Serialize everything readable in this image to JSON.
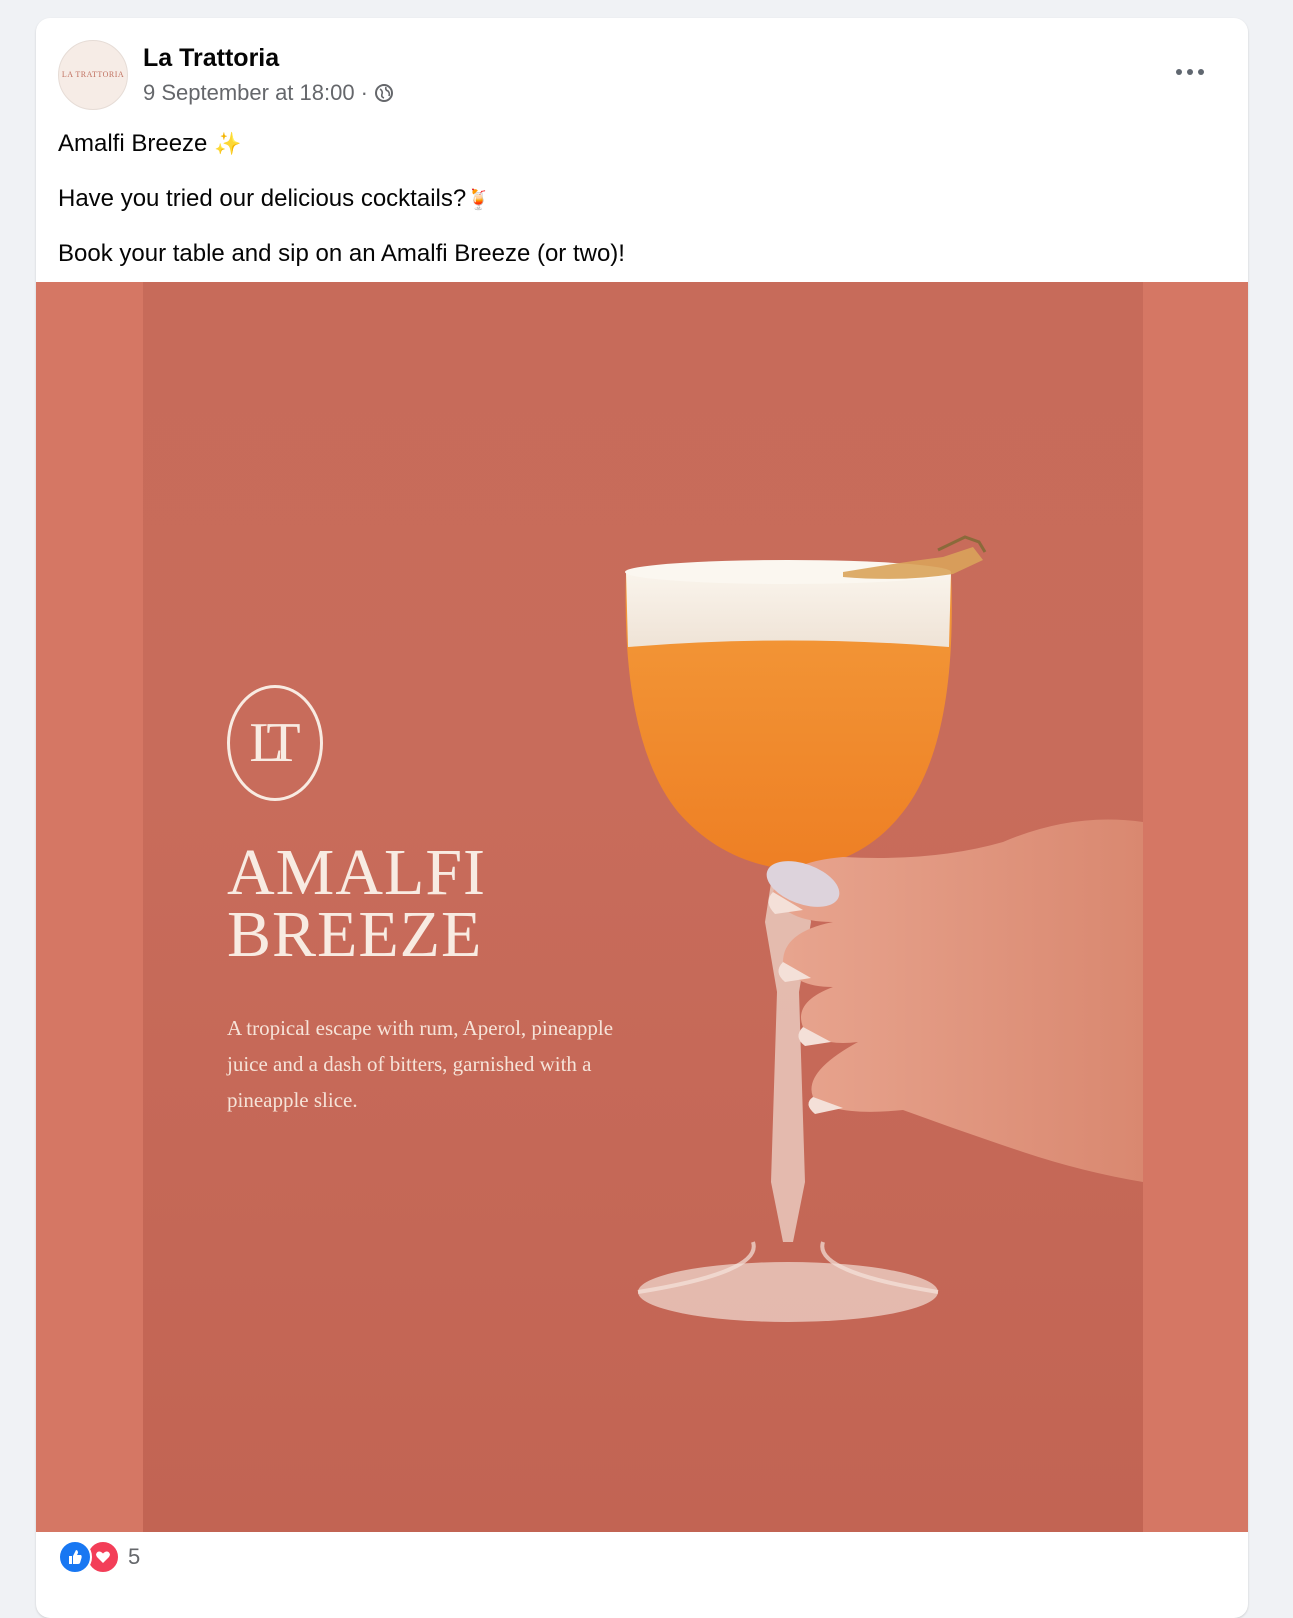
{
  "post": {
    "page_name": "La Trattoria",
    "avatar_text": "LA TRATTORIA",
    "timestamp": "9 September at 18:00",
    "separator": "·",
    "audience_icon": "globe-icon",
    "more_icon": "more-options-icon",
    "lines": {
      "line1": "Amalfi Breeze",
      "line1_emoji": "✨",
      "line2": "Have you tried our delicious cocktails?",
      "line2_emoji": "🍹",
      "line3": "Book your table and sip on an Amalfi Breeze (or two)!"
    }
  },
  "image": {
    "logo": "LT",
    "title_line1": "AMALFI",
    "title_line2": "BREEZE",
    "description": "A tropical escape with rum, Aperol, pineapple juice and a dash of bitters, garnished with a pineapple slice.",
    "colors": {
      "background": "#c76b5a",
      "text": "#f8ebe2",
      "drink": "#f0892f",
      "foam": "#f5ede4"
    }
  },
  "reactions": {
    "like_icon": "like-icon",
    "love_icon": "love-icon",
    "count": "5"
  }
}
